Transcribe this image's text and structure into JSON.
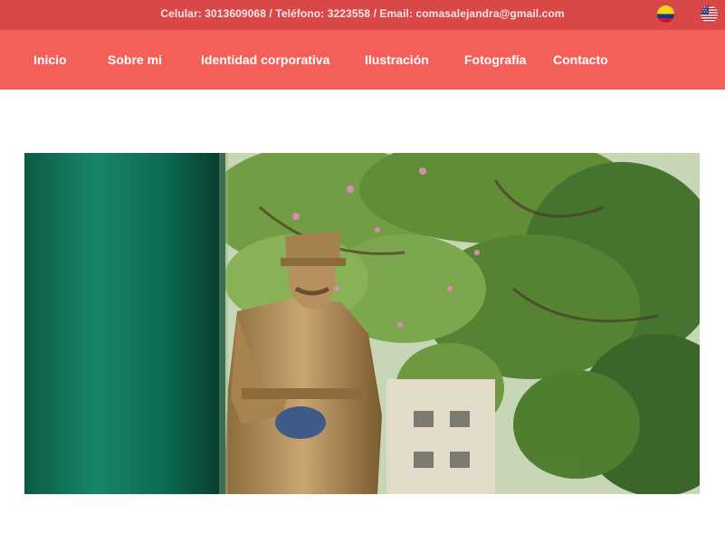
{
  "topbar": {
    "contact_text": "Celular: 3013609068 / Teléfono: 3223558 / Email: comasalejandra@gmail.com",
    "background": "#d94747"
  },
  "languages": [
    {
      "icon": "colombia-flag-icon"
    },
    {
      "icon": "usa-flag-icon"
    }
  ],
  "nav": {
    "background": "#f45f5a",
    "items": [
      {
        "label": "Inicio"
      },
      {
        "label": "Sobre mi"
      },
      {
        "label": "Identidad corporativa"
      },
      {
        "label": "Ilustración"
      },
      {
        "label": "Fotografía"
      },
      {
        "label": "Contacto"
      }
    ]
  },
  "main": {
    "hero_image": "photo-statue-military-officer-under-trees"
  }
}
